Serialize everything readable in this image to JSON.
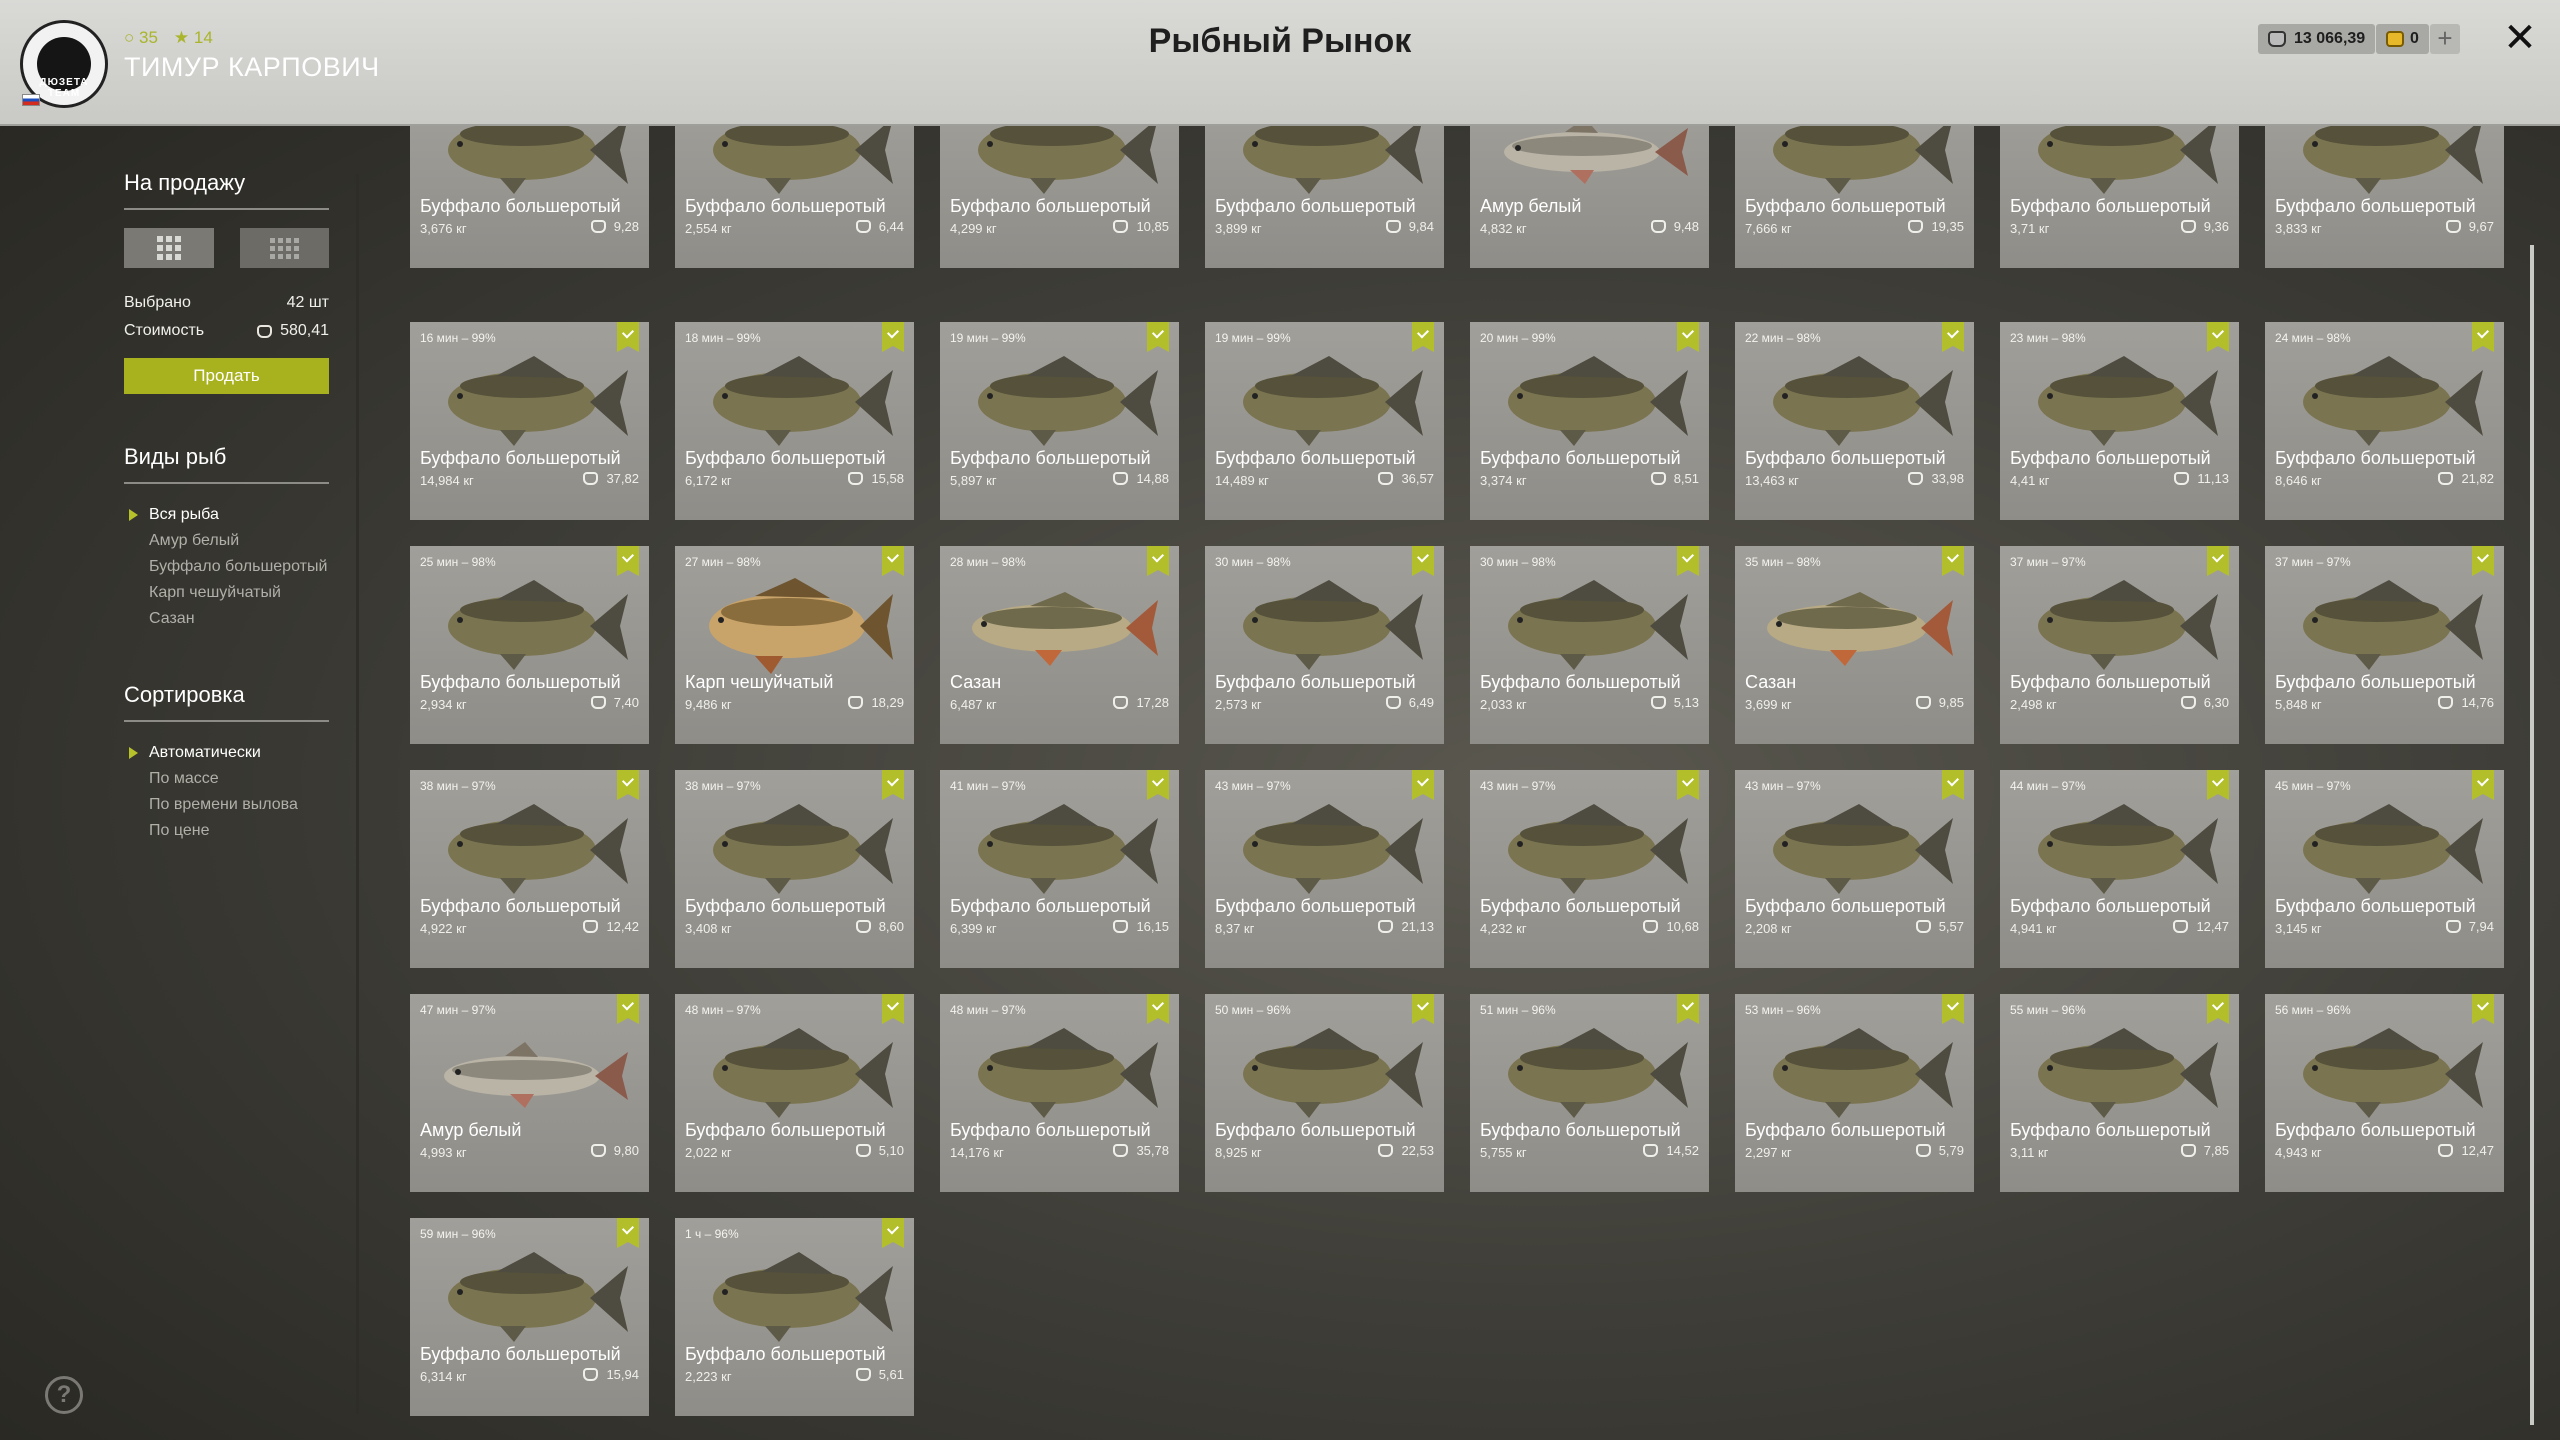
{
  "header": {
    "title": "Рыбный Рынок",
    "user_name": "ТИМУР КАРПОВИЧ",
    "level": "35",
    "stars": "14",
    "avatar_text": "ДЮЗЕТА TEAM",
    "money": "13 066,39",
    "gold": "0"
  },
  "sidebar": {
    "for_sale_title": "На продажу",
    "selected_label": "Выбрано",
    "selected_value": "42 шт",
    "cost_label": "Стоимость",
    "cost_value": "580,41",
    "sell_label": "Продать",
    "species_title": "Виды рыб",
    "species": [
      "Вся рыба",
      "Амур белый",
      "Буффало большеротый",
      "Карп чешуйчатый",
      "Сазан"
    ],
    "species_active": 0,
    "sort_title": "Сортировка",
    "sort_options": [
      "Автоматически",
      "По массе",
      "По времени вылова",
      "По цене"
    ],
    "sort_active": 0
  },
  "cards": [
    {
      "time": "",
      "name": "Буффало большеротый",
      "weight": "3,676 кг",
      "price": "9,28",
      "fish": "buffalo",
      "checked": false
    },
    {
      "time": "",
      "name": "Буффало большеротый",
      "weight": "2,554 кг",
      "price": "6,44",
      "fish": "buffalo",
      "checked": false
    },
    {
      "time": "",
      "name": "Буффало большеротый",
      "weight": "4,299 кг",
      "price": "10,85",
      "fish": "buffalo",
      "checked": false
    },
    {
      "time": "",
      "name": "Буффало большеротый",
      "weight": "3,899 кг",
      "price": "9,84",
      "fish": "buffalo",
      "checked": false
    },
    {
      "time": "",
      "name": "Амур белый",
      "weight": "4,832 кг",
      "price": "9,48",
      "fish": "amur",
      "checked": false
    },
    {
      "time": "",
      "name": "Буффало большеротый",
      "weight": "7,666 кг",
      "price": "19,35",
      "fish": "buffalo",
      "checked": false
    },
    {
      "time": "",
      "name": "Буффало большеротый",
      "weight": "3,71 кг",
      "price": "9,36",
      "fish": "buffalo",
      "checked": false
    },
    {
      "time": "",
      "name": "Буффало большеротый",
      "weight": "3,833 кг",
      "price": "9,67",
      "fish": "buffalo",
      "checked": false
    },
    {
      "time": "16 мин – 99%",
      "name": "Буффало большеротый",
      "weight": "14,984 кг",
      "price": "37,82",
      "fish": "buffalo",
      "checked": true
    },
    {
      "time": "18 мин – 99%",
      "name": "Буффало большеротый",
      "weight": "6,172 кг",
      "price": "15,58",
      "fish": "buffalo",
      "checked": true
    },
    {
      "time": "19 мин – 99%",
      "name": "Буффало большеротый",
      "weight": "5,897 кг",
      "price": "14,88",
      "fish": "buffalo",
      "checked": true
    },
    {
      "time": "19 мин – 99%",
      "name": "Буффало большеротый",
      "weight": "14,489 кг",
      "price": "36,57",
      "fish": "buffalo",
      "checked": true
    },
    {
      "time": "20 мин – 99%",
      "name": "Буффало большеротый",
      "weight": "3,374 кг",
      "price": "8,51",
      "fish": "buffalo",
      "checked": true
    },
    {
      "time": "22 мин – 98%",
      "name": "Буффало большеротый",
      "weight": "13,463 кг",
      "price": "33,98",
      "fish": "buffalo",
      "checked": true
    },
    {
      "time": "23 мин – 98%",
      "name": "Буффало большеротый",
      "weight": "4,41 кг",
      "price": "11,13",
      "fish": "buffalo",
      "checked": true
    },
    {
      "time": "24 мин – 98%",
      "name": "Буффало большеротый",
      "weight": "8,646 кг",
      "price": "21,82",
      "fish": "buffalo",
      "checked": true
    },
    {
      "time": "25 мин – 98%",
      "name": "Буффало большеротый",
      "weight": "2,934 кг",
      "price": "7,40",
      "fish": "buffalo",
      "checked": true
    },
    {
      "time": "27 мин – 98%",
      "name": "Карп чешуйчатый",
      "weight": "9,486 кг",
      "price": "18,29",
      "fish": "carp",
      "checked": true
    },
    {
      "time": "28 мин – 98%",
      "name": "Сазан",
      "weight": "6,487 кг",
      "price": "17,28",
      "fish": "sazan",
      "checked": true
    },
    {
      "time": "30 мин – 98%",
      "name": "Буффало большеротый",
      "weight": "2,573 кг",
      "price": "6,49",
      "fish": "buffalo",
      "checked": true
    },
    {
      "time": "30 мин – 98%",
      "name": "Буффало большеротый",
      "weight": "2,033 кг",
      "price": "5,13",
      "fish": "buffalo",
      "checked": true
    },
    {
      "time": "35 мин – 98%",
      "name": "Сазан",
      "weight": "3,699 кг",
      "price": "9,85",
      "fish": "sazan",
      "checked": true
    },
    {
      "time": "37 мин – 97%",
      "name": "Буффало большеротый",
      "weight": "2,498 кг",
      "price": "6,30",
      "fish": "buffalo",
      "checked": true
    },
    {
      "time": "37 мин – 97%",
      "name": "Буффало большеротый",
      "weight": "5,848 кг",
      "price": "14,76",
      "fish": "buffalo",
      "checked": true
    },
    {
      "time": "38 мин – 97%",
      "name": "Буффало большеротый",
      "weight": "4,922 кг",
      "price": "12,42",
      "fish": "buffalo",
      "checked": true
    },
    {
      "time": "38 мин – 97%",
      "name": "Буффало большеротый",
      "weight": "3,408 кг",
      "price": "8,60",
      "fish": "buffalo",
      "checked": true
    },
    {
      "time": "41 мин – 97%",
      "name": "Буффало большеротый",
      "weight": "6,399 кг",
      "price": "16,15",
      "fish": "buffalo",
      "checked": true
    },
    {
      "time": "43 мин – 97%",
      "name": "Буффало большеротый",
      "weight": "8,37 кг",
      "price": "21,13",
      "fish": "buffalo",
      "checked": true
    },
    {
      "time": "43 мин – 97%",
      "name": "Буффало большеротый",
      "weight": "4,232 кг",
      "price": "10,68",
      "fish": "buffalo",
      "checked": true
    },
    {
      "time": "43 мин – 97%",
      "name": "Буффало большеротый",
      "weight": "2,208 кг",
      "price": "5,57",
      "fish": "buffalo",
      "checked": true
    },
    {
      "time": "44 мин – 97%",
      "name": "Буффало большеротый",
      "weight": "4,941 кг",
      "price": "12,47",
      "fish": "buffalo",
      "checked": true
    },
    {
      "time": "45 мин – 97%",
      "name": "Буффало большеротый",
      "weight": "3,145 кг",
      "price": "7,94",
      "fish": "buffalo",
      "checked": true
    },
    {
      "time": "47 мин – 97%",
      "name": "Амур белый",
      "weight": "4,993 кг",
      "price": "9,80",
      "fish": "amur",
      "checked": true
    },
    {
      "time": "48 мин – 97%",
      "name": "Буффало большеротый",
      "weight": "2,022 кг",
      "price": "5,10",
      "fish": "buffalo",
      "checked": true
    },
    {
      "time": "48 мин – 97%",
      "name": "Буффало большеротый",
      "weight": "14,176 кг",
      "price": "35,78",
      "fish": "buffalo",
      "checked": true
    },
    {
      "time": "50 мин – 96%",
      "name": "Буффало большеротый",
      "weight": "8,925 кг",
      "price": "22,53",
      "fish": "buffalo",
      "checked": true
    },
    {
      "time": "51 мин – 96%",
      "name": "Буффало большеротый",
      "weight": "5,755 кг",
      "price": "14,52",
      "fish": "buffalo",
      "checked": true
    },
    {
      "time": "53 мин – 96%",
      "name": "Буффало большеротый",
      "weight": "2,297 кг",
      "price": "5,79",
      "fish": "buffalo",
      "checked": true
    },
    {
      "time": "55 мин – 96%",
      "name": "Буффало большеротый",
      "weight": "3,11 кг",
      "price": "7,85",
      "fish": "buffalo",
      "checked": true
    },
    {
      "time": "56 мин – 96%",
      "name": "Буффало большеротый",
      "weight": "4,943 кг",
      "price": "12,47",
      "fish": "buffalo",
      "checked": true
    },
    {
      "time": "59 мин – 96%",
      "name": "Буффало большеротый",
      "weight": "6,314 кг",
      "price": "15,94",
      "fish": "buffalo",
      "checked": true
    },
    {
      "time": "1 ч – 96%",
      "name": "Буффало большеротый",
      "weight": "2,223 кг",
      "price": "5,61",
      "fish": "buffalo",
      "checked": true
    }
  ],
  "colors": {
    "accent": "#a8b21f",
    "buffalo_body": "#7a7450",
    "amur_body": "#b9b4a6",
    "carp_body": "#c9a46a",
    "sazan_body": "#b7aa84"
  }
}
